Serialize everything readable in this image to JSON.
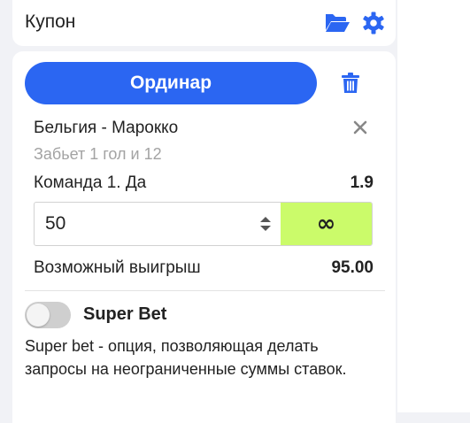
{
  "header": {
    "title": "Купон",
    "icons": [
      "folder-open-icon",
      "gear-icon"
    ]
  },
  "coupon": {
    "mode_button_label": "Ординар",
    "delete_icon": "trash-icon",
    "bet": {
      "match": "Бельгия - Марокко",
      "market": "Забьет 1 гол и 12",
      "outcome": "Команда 1. Да",
      "odds": "1.9"
    },
    "stake": {
      "value": "50",
      "max_label": "∞"
    },
    "potential_win": {
      "label": "Возможный выигрыш",
      "value": "95.00"
    },
    "super_bet": {
      "enabled": false,
      "title": "Super Bet",
      "description": "Super bet - опция, позволяющая делать запросы на неограниченные суммы ставок."
    }
  },
  "colors": {
    "accent": "#2b66f2",
    "max_button": "#cbfb6a",
    "background": "#f1f2f6"
  }
}
